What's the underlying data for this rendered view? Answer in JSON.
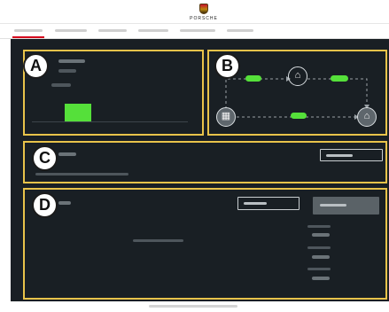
{
  "header": {
    "brand": "PORSCHE",
    "crest_icon": "porsche-crest-icon"
  },
  "tabs": [
    {
      "label": "",
      "active": true
    },
    {
      "label": "",
      "active": false
    },
    {
      "label": "",
      "active": false
    },
    {
      "label": "",
      "active": false
    },
    {
      "label": "",
      "active": false
    },
    {
      "label": "",
      "active": false
    }
  ],
  "annotations": {
    "a": "A",
    "b": "B",
    "c": "C",
    "d": "D"
  },
  "flow": {
    "nodes": {
      "pv": "solar-panel-icon",
      "grid": "power-pylon-icon",
      "house": "house-icon"
    },
    "pill_color": "#55e03a"
  },
  "colors": {
    "accent": "#d5001c",
    "panel_border": "#e8c34a",
    "energy": "#55e03a",
    "background": "#191f24"
  }
}
